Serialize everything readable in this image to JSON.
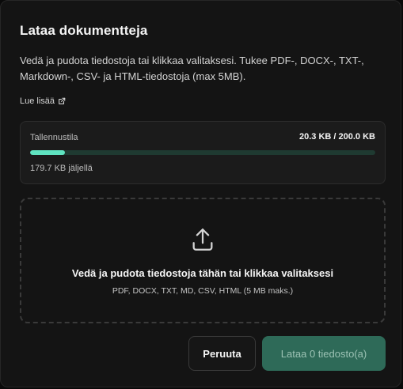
{
  "dialog": {
    "title": "Lataa dokumentteja",
    "description": "Vedä ja pudota tiedostoja tai klikkaa valitaksesi. Tukee PDF-, DOCX-, TXT-, Markdown-, CSV- ja HTML-tiedostoja (max 5MB).",
    "learn_more": "Lue lisää",
    "learn_more_icon": "external-link-icon"
  },
  "storage": {
    "label": "Tallennustila",
    "usage": "20.3 KB / 200.0 KB",
    "used_fraction": 0.1015,
    "remaining": "179.7 KB jäljellä",
    "colors": {
      "fill": "#5fe3c0",
      "track": "#1f3a31"
    }
  },
  "dropzone": {
    "icon": "upload-icon",
    "title": "Vedä ja pudota tiedostoja tähän tai klikkaa valitaksesi",
    "subtitle": "PDF, DOCX, TXT, MD, CSV, HTML (5 MB maks.)"
  },
  "actions": {
    "cancel_label": "Peruuta",
    "upload_label": "Lataa 0 tiedosto(a)",
    "upload_color": "#2e6a58"
  }
}
